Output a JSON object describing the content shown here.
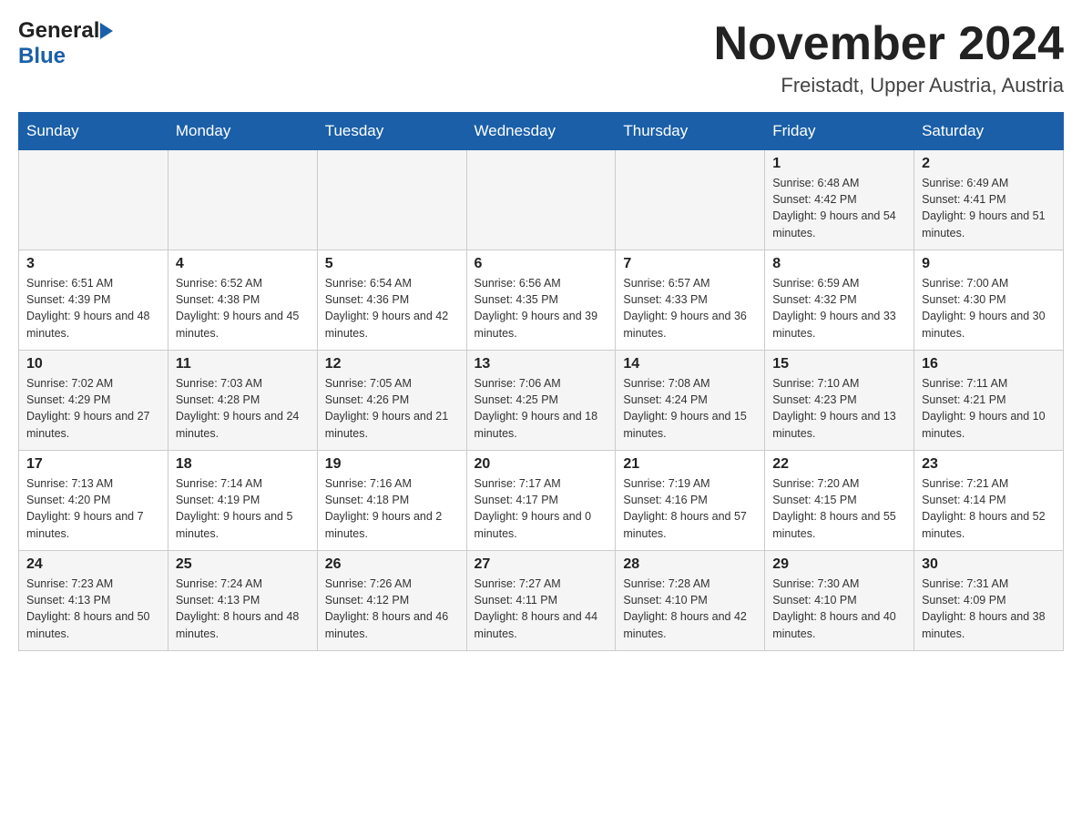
{
  "header": {
    "logo_general": "General",
    "logo_blue": "Blue",
    "month_title": "November 2024",
    "location": "Freistadt, Upper Austria, Austria"
  },
  "days_of_week": [
    "Sunday",
    "Monday",
    "Tuesday",
    "Wednesday",
    "Thursday",
    "Friday",
    "Saturday"
  ],
  "weeks": [
    [
      {
        "num": "",
        "info": ""
      },
      {
        "num": "",
        "info": ""
      },
      {
        "num": "",
        "info": ""
      },
      {
        "num": "",
        "info": ""
      },
      {
        "num": "",
        "info": ""
      },
      {
        "num": "1",
        "info": "Sunrise: 6:48 AM\nSunset: 4:42 PM\nDaylight: 9 hours and 54 minutes."
      },
      {
        "num": "2",
        "info": "Sunrise: 6:49 AM\nSunset: 4:41 PM\nDaylight: 9 hours and 51 minutes."
      }
    ],
    [
      {
        "num": "3",
        "info": "Sunrise: 6:51 AM\nSunset: 4:39 PM\nDaylight: 9 hours and 48 minutes."
      },
      {
        "num": "4",
        "info": "Sunrise: 6:52 AM\nSunset: 4:38 PM\nDaylight: 9 hours and 45 minutes."
      },
      {
        "num": "5",
        "info": "Sunrise: 6:54 AM\nSunset: 4:36 PM\nDaylight: 9 hours and 42 minutes."
      },
      {
        "num": "6",
        "info": "Sunrise: 6:56 AM\nSunset: 4:35 PM\nDaylight: 9 hours and 39 minutes."
      },
      {
        "num": "7",
        "info": "Sunrise: 6:57 AM\nSunset: 4:33 PM\nDaylight: 9 hours and 36 minutes."
      },
      {
        "num": "8",
        "info": "Sunrise: 6:59 AM\nSunset: 4:32 PM\nDaylight: 9 hours and 33 minutes."
      },
      {
        "num": "9",
        "info": "Sunrise: 7:00 AM\nSunset: 4:30 PM\nDaylight: 9 hours and 30 minutes."
      }
    ],
    [
      {
        "num": "10",
        "info": "Sunrise: 7:02 AM\nSunset: 4:29 PM\nDaylight: 9 hours and 27 minutes."
      },
      {
        "num": "11",
        "info": "Sunrise: 7:03 AM\nSunset: 4:28 PM\nDaylight: 9 hours and 24 minutes."
      },
      {
        "num": "12",
        "info": "Sunrise: 7:05 AM\nSunset: 4:26 PM\nDaylight: 9 hours and 21 minutes."
      },
      {
        "num": "13",
        "info": "Sunrise: 7:06 AM\nSunset: 4:25 PM\nDaylight: 9 hours and 18 minutes."
      },
      {
        "num": "14",
        "info": "Sunrise: 7:08 AM\nSunset: 4:24 PM\nDaylight: 9 hours and 15 minutes."
      },
      {
        "num": "15",
        "info": "Sunrise: 7:10 AM\nSunset: 4:23 PM\nDaylight: 9 hours and 13 minutes."
      },
      {
        "num": "16",
        "info": "Sunrise: 7:11 AM\nSunset: 4:21 PM\nDaylight: 9 hours and 10 minutes."
      }
    ],
    [
      {
        "num": "17",
        "info": "Sunrise: 7:13 AM\nSunset: 4:20 PM\nDaylight: 9 hours and 7 minutes."
      },
      {
        "num": "18",
        "info": "Sunrise: 7:14 AM\nSunset: 4:19 PM\nDaylight: 9 hours and 5 minutes."
      },
      {
        "num": "19",
        "info": "Sunrise: 7:16 AM\nSunset: 4:18 PM\nDaylight: 9 hours and 2 minutes."
      },
      {
        "num": "20",
        "info": "Sunrise: 7:17 AM\nSunset: 4:17 PM\nDaylight: 9 hours and 0 minutes."
      },
      {
        "num": "21",
        "info": "Sunrise: 7:19 AM\nSunset: 4:16 PM\nDaylight: 8 hours and 57 minutes."
      },
      {
        "num": "22",
        "info": "Sunrise: 7:20 AM\nSunset: 4:15 PM\nDaylight: 8 hours and 55 minutes."
      },
      {
        "num": "23",
        "info": "Sunrise: 7:21 AM\nSunset: 4:14 PM\nDaylight: 8 hours and 52 minutes."
      }
    ],
    [
      {
        "num": "24",
        "info": "Sunrise: 7:23 AM\nSunset: 4:13 PM\nDaylight: 8 hours and 50 minutes."
      },
      {
        "num": "25",
        "info": "Sunrise: 7:24 AM\nSunset: 4:13 PM\nDaylight: 8 hours and 48 minutes."
      },
      {
        "num": "26",
        "info": "Sunrise: 7:26 AM\nSunset: 4:12 PM\nDaylight: 8 hours and 46 minutes."
      },
      {
        "num": "27",
        "info": "Sunrise: 7:27 AM\nSunset: 4:11 PM\nDaylight: 8 hours and 44 minutes."
      },
      {
        "num": "28",
        "info": "Sunrise: 7:28 AM\nSunset: 4:10 PM\nDaylight: 8 hours and 42 minutes."
      },
      {
        "num": "29",
        "info": "Sunrise: 7:30 AM\nSunset: 4:10 PM\nDaylight: 8 hours and 40 minutes."
      },
      {
        "num": "30",
        "info": "Sunrise: 7:31 AM\nSunset: 4:09 PM\nDaylight: 8 hours and 38 minutes."
      }
    ]
  ]
}
